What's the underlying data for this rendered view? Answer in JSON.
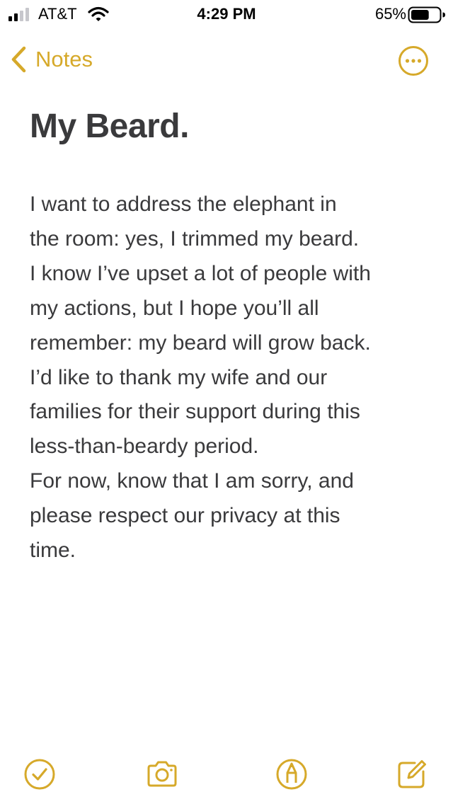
{
  "status_bar": {
    "carrier": "AT&T",
    "time": "4:29 PM",
    "battery_percent": "65%",
    "battery_level": 0.65,
    "signal_bars": 2
  },
  "nav": {
    "back_label": "Notes",
    "back_icon": "chevron-left-icon",
    "more_icon": "ellipsis-circle-icon"
  },
  "note": {
    "title": "My Beard.",
    "lines": [
      "I want to address the elephant in",
      "the room: yes, I trimmed my beard.",
      "I know I’ve upset a lot of people with",
      "my actions, but I hope you’ll all",
      "remember: my beard will grow back.",
      "I’d like to thank my wife and our",
      "families for their support during this",
      "less-than-beardy period.",
      "For now, know that I am sorry, and",
      "please respect our privacy at this",
      "time."
    ]
  },
  "toolbar": {
    "icons": [
      "checklist-icon",
      "camera-icon",
      "markup-icon",
      "compose-icon"
    ]
  },
  "colors": {
    "accent": "#d6a92a",
    "text": "#3a3a3c",
    "background": "#ffffff"
  }
}
